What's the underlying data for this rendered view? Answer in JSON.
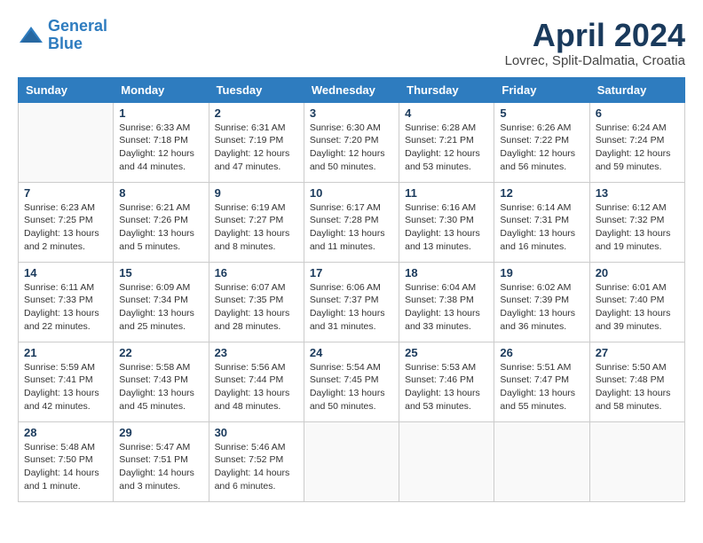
{
  "header": {
    "logo_line1": "General",
    "logo_line2": "Blue",
    "month_title": "April 2024",
    "subtitle": "Lovrec, Split-Dalmatia, Croatia"
  },
  "days_of_week": [
    "Sunday",
    "Monday",
    "Tuesday",
    "Wednesday",
    "Thursday",
    "Friday",
    "Saturday"
  ],
  "weeks": [
    [
      {
        "day": "",
        "info": ""
      },
      {
        "day": "1",
        "info": "Sunrise: 6:33 AM\nSunset: 7:18 PM\nDaylight: 12 hours\nand 44 minutes."
      },
      {
        "day": "2",
        "info": "Sunrise: 6:31 AM\nSunset: 7:19 PM\nDaylight: 12 hours\nand 47 minutes."
      },
      {
        "day": "3",
        "info": "Sunrise: 6:30 AM\nSunset: 7:20 PM\nDaylight: 12 hours\nand 50 minutes."
      },
      {
        "day": "4",
        "info": "Sunrise: 6:28 AM\nSunset: 7:21 PM\nDaylight: 12 hours\nand 53 minutes."
      },
      {
        "day": "5",
        "info": "Sunrise: 6:26 AM\nSunset: 7:22 PM\nDaylight: 12 hours\nand 56 minutes."
      },
      {
        "day": "6",
        "info": "Sunrise: 6:24 AM\nSunset: 7:24 PM\nDaylight: 12 hours\nand 59 minutes."
      }
    ],
    [
      {
        "day": "7",
        "info": "Sunrise: 6:23 AM\nSunset: 7:25 PM\nDaylight: 13 hours\nand 2 minutes."
      },
      {
        "day": "8",
        "info": "Sunrise: 6:21 AM\nSunset: 7:26 PM\nDaylight: 13 hours\nand 5 minutes."
      },
      {
        "day": "9",
        "info": "Sunrise: 6:19 AM\nSunset: 7:27 PM\nDaylight: 13 hours\nand 8 minutes."
      },
      {
        "day": "10",
        "info": "Sunrise: 6:17 AM\nSunset: 7:28 PM\nDaylight: 13 hours\nand 11 minutes."
      },
      {
        "day": "11",
        "info": "Sunrise: 6:16 AM\nSunset: 7:30 PM\nDaylight: 13 hours\nand 13 minutes."
      },
      {
        "day": "12",
        "info": "Sunrise: 6:14 AM\nSunset: 7:31 PM\nDaylight: 13 hours\nand 16 minutes."
      },
      {
        "day": "13",
        "info": "Sunrise: 6:12 AM\nSunset: 7:32 PM\nDaylight: 13 hours\nand 19 minutes."
      }
    ],
    [
      {
        "day": "14",
        "info": "Sunrise: 6:11 AM\nSunset: 7:33 PM\nDaylight: 13 hours\nand 22 minutes."
      },
      {
        "day": "15",
        "info": "Sunrise: 6:09 AM\nSunset: 7:34 PM\nDaylight: 13 hours\nand 25 minutes."
      },
      {
        "day": "16",
        "info": "Sunrise: 6:07 AM\nSunset: 7:35 PM\nDaylight: 13 hours\nand 28 minutes."
      },
      {
        "day": "17",
        "info": "Sunrise: 6:06 AM\nSunset: 7:37 PM\nDaylight: 13 hours\nand 31 minutes."
      },
      {
        "day": "18",
        "info": "Sunrise: 6:04 AM\nSunset: 7:38 PM\nDaylight: 13 hours\nand 33 minutes."
      },
      {
        "day": "19",
        "info": "Sunrise: 6:02 AM\nSunset: 7:39 PM\nDaylight: 13 hours\nand 36 minutes."
      },
      {
        "day": "20",
        "info": "Sunrise: 6:01 AM\nSunset: 7:40 PM\nDaylight: 13 hours\nand 39 minutes."
      }
    ],
    [
      {
        "day": "21",
        "info": "Sunrise: 5:59 AM\nSunset: 7:41 PM\nDaylight: 13 hours\nand 42 minutes."
      },
      {
        "day": "22",
        "info": "Sunrise: 5:58 AM\nSunset: 7:43 PM\nDaylight: 13 hours\nand 45 minutes."
      },
      {
        "day": "23",
        "info": "Sunrise: 5:56 AM\nSunset: 7:44 PM\nDaylight: 13 hours\nand 48 minutes."
      },
      {
        "day": "24",
        "info": "Sunrise: 5:54 AM\nSunset: 7:45 PM\nDaylight: 13 hours\nand 50 minutes."
      },
      {
        "day": "25",
        "info": "Sunrise: 5:53 AM\nSunset: 7:46 PM\nDaylight: 13 hours\nand 53 minutes."
      },
      {
        "day": "26",
        "info": "Sunrise: 5:51 AM\nSunset: 7:47 PM\nDaylight: 13 hours\nand 55 minutes."
      },
      {
        "day": "27",
        "info": "Sunrise: 5:50 AM\nSunset: 7:48 PM\nDaylight: 13 hours\nand 58 minutes."
      }
    ],
    [
      {
        "day": "28",
        "info": "Sunrise: 5:48 AM\nSunset: 7:50 PM\nDaylight: 14 hours\nand 1 minute."
      },
      {
        "day": "29",
        "info": "Sunrise: 5:47 AM\nSunset: 7:51 PM\nDaylight: 14 hours\nand 3 minutes."
      },
      {
        "day": "30",
        "info": "Sunrise: 5:46 AM\nSunset: 7:52 PM\nDaylight: 14 hours\nand 6 minutes."
      },
      {
        "day": "",
        "info": ""
      },
      {
        "day": "",
        "info": ""
      },
      {
        "day": "",
        "info": ""
      },
      {
        "day": "",
        "info": ""
      }
    ]
  ]
}
